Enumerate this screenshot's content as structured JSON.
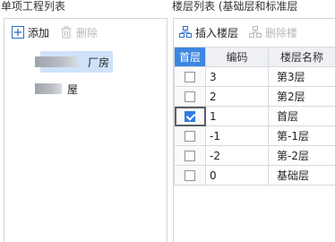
{
  "left_panel": {
    "title": "单项工程列表",
    "toolbar": {
      "add_label": "添加",
      "delete_label": "删除"
    },
    "tree_items": [
      {
        "label": "厂房",
        "selected": true
      },
      {
        "label": "屋",
        "selected": false
      }
    ]
  },
  "right_panel": {
    "title": "楼层列表 (基础层和标准层",
    "toolbar": {
      "insert_label": "插入楼层",
      "delete_label": "删除楼"
    },
    "columns": [
      "首层",
      "编码",
      "楼层名称"
    ],
    "rows": [
      {
        "checked": false,
        "code": "3",
        "name": "第3层"
      },
      {
        "checked": false,
        "code": "2",
        "name": "第2层"
      },
      {
        "checked": true,
        "code": "1",
        "name": "首层"
      },
      {
        "checked": false,
        "code": "-1",
        "name": "第-1层"
      },
      {
        "checked": false,
        "code": "-2",
        "name": "第-2层"
      },
      {
        "checked": false,
        "code": "0",
        "name": "基础层"
      }
    ]
  },
  "colors": {
    "header_selected": "#3e86e1",
    "tree_selected": "#cfe2f9",
    "checkbox_checked": "#2d7be0"
  }
}
